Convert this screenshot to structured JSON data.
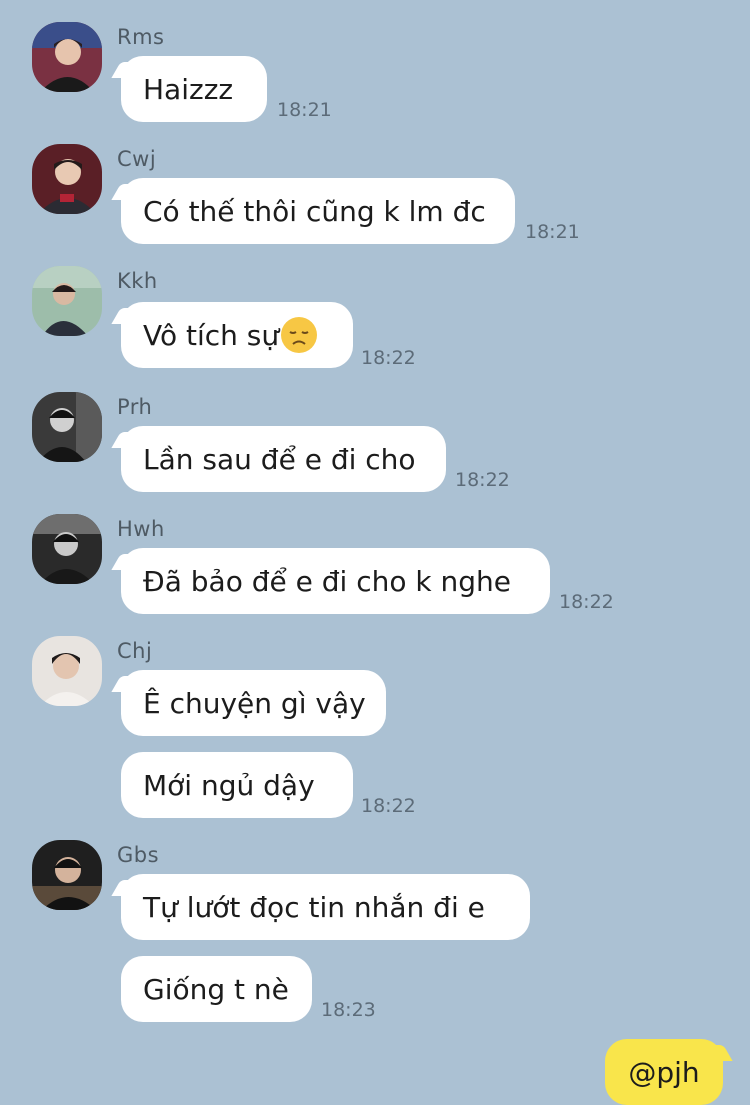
{
  "colors": {
    "background": "#abc1d3",
    "bubble": "#ffffff",
    "own_bubble": "#f9e54b"
  },
  "messages": [
    {
      "sender": "Rms",
      "texts": [
        "Haizzz"
      ],
      "time": "18:21"
    },
    {
      "sender": "Cwj",
      "texts": [
        "Có thế thôi cũng k lm đc"
      ],
      "time": "18:21"
    },
    {
      "sender": "Kkh",
      "texts": [
        "Vô tích sự"
      ],
      "emoji": "disappointed-face-icon",
      "time": "18:22"
    },
    {
      "sender": "Prh",
      "texts": [
        "Lần sau để e đi cho"
      ],
      "time": "18:22"
    },
    {
      "sender": "Hwh",
      "texts": [
        "Đã bảo để e đi cho k nghe"
      ],
      "time": "18:22"
    },
    {
      "sender": "Chj",
      "texts": [
        "Ê chuyện gì vậy",
        "Mới ngủ dậy"
      ],
      "time": "18:22"
    },
    {
      "sender": "Gbs",
      "texts": [
        "Tự lướt đọc tin nhắn đi e",
        "Giống t nè"
      ],
      "time": "18:23"
    }
  ],
  "own_message": {
    "text": "@pjh"
  }
}
